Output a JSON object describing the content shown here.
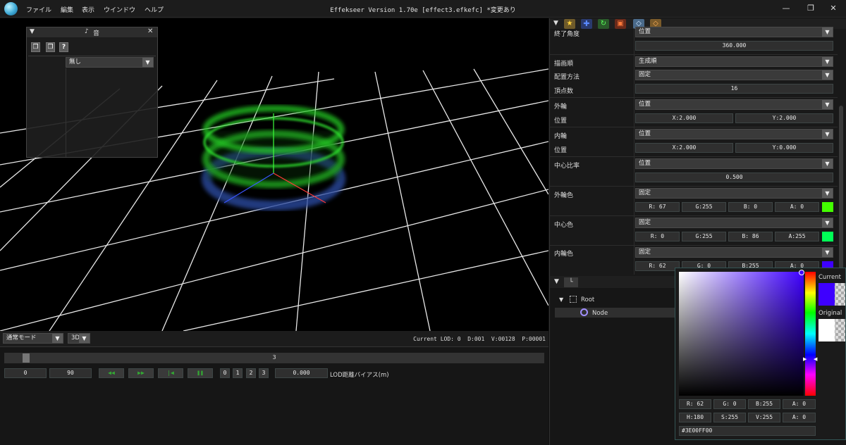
{
  "titlebar": {
    "title": "Effekseer Version 1.70e [effect3.efkefc] *変更あり",
    "menu": [
      "ファイル",
      "編集",
      "表示",
      "ウインドウ",
      "ヘルプ"
    ]
  },
  "sound_panel": {
    "title": "音",
    "dropdown": "無し",
    "help": "?"
  },
  "viewport": {
    "mode": "通常モード",
    "view": "3D",
    "status": "Current LOD: 0  D:001  V:00128  P:00001"
  },
  "timeline": {
    "frame": "3",
    "start": "0",
    "end": "90",
    "lod_buttons": [
      "0",
      "1",
      "2",
      "3"
    ],
    "lod_value": "0.000",
    "lod_label": "LOD距離バイアス(m)"
  },
  "properties": {
    "end_angle_label": "終了角度",
    "end_angle_mode": "位置",
    "end_angle_value": "360.000",
    "draw_order_label": "描画順",
    "draw_order_value": "生成順",
    "placement_label": "配置方法",
    "placement_value": "固定",
    "vertex_label": "頂点数",
    "vertex_value": "16",
    "outer_label": "外輪",
    "outer_mode": "位置",
    "outer_pos_label": "位置",
    "outer_x": "X:2.000",
    "outer_y": "Y:2.000",
    "inner_label": "内輪",
    "inner_mode": "位置",
    "inner_pos_label": "位置",
    "inner_x": "X:2.000",
    "inner_y": "Y:0.000",
    "center_ratio_label": "中心比率",
    "center_ratio_mode": "位置",
    "center_ratio_value": "0.500",
    "outer_color_label": "外輪色",
    "outer_color_mode": "固定",
    "outer_color": [
      "R: 67",
      "G:255",
      "B:  0",
      "A:  0"
    ],
    "outer_swatch": "#43ff00",
    "center_color_label": "中心色",
    "center_color_mode": "固定",
    "center_color": [
      "R:  0",
      "G:255",
      "B: 86",
      "A:255"
    ],
    "center_swatch": "#00ff56",
    "inner_color_label": "内輪色",
    "inner_color_mode": "固定",
    "inner_color": [
      "R: 62",
      "G:  0",
      "B:255",
      "A:  0"
    ],
    "inner_swatch": "#3e00ff"
  },
  "node_tree": {
    "root": "Root",
    "node": "Node"
  },
  "color_picker": {
    "current_label": "Current",
    "original_label": "Original",
    "rgba": [
      "R: 62",
      "G:  0",
      "B:255",
      "A:  0"
    ],
    "hsva": [
      "H:180",
      "S:255",
      "V:255",
      "A:  0"
    ],
    "hex": "#3E00FF00",
    "current_color": "#3e00ff",
    "original_color": "#ffffff"
  }
}
